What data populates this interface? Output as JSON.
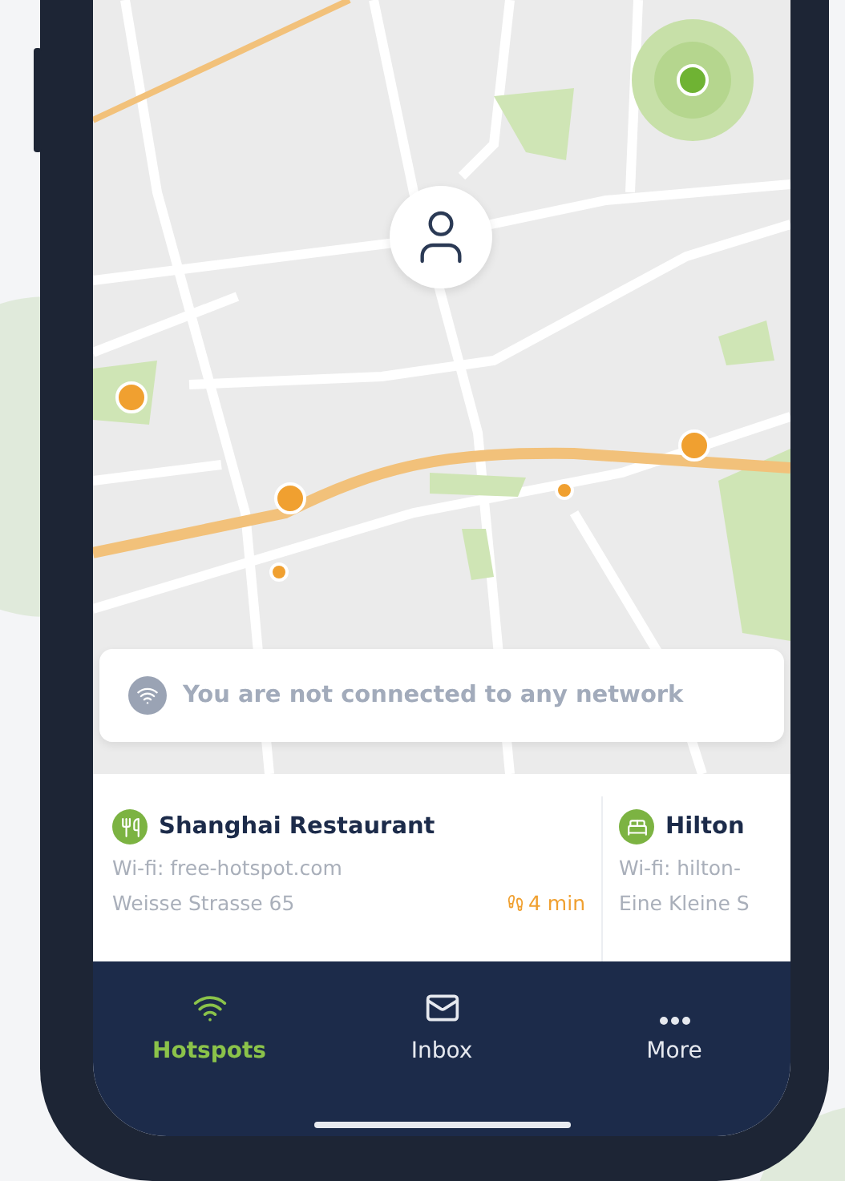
{
  "notice": {
    "text": "You are not connected to any network"
  },
  "places": [
    {
      "kind": "restaurant",
      "name": "Shanghai Restaurant",
      "wifi": "Wi-fi: free-hotspot.com",
      "address": "Weisse Strasse 65",
      "walk_time": "4 min"
    },
    {
      "kind": "hotel",
      "name": "Hilton",
      "wifi": "Wi-fi: hilton-",
      "address": "Eine Kleine S"
    }
  ],
  "tabs": [
    {
      "kind": "wifi",
      "label": "Hotspots",
      "selected": true
    },
    {
      "kind": "mail",
      "label": "Inbox",
      "selected": false
    },
    {
      "kind": "more",
      "label": "More",
      "selected": false
    }
  ]
}
